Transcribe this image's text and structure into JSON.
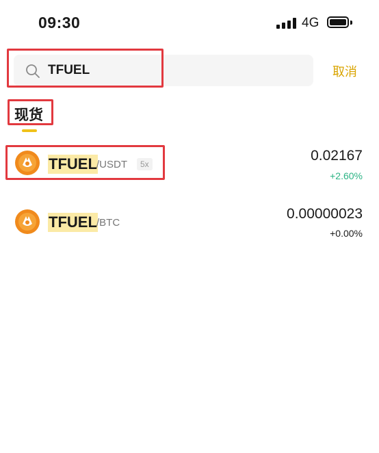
{
  "status_bar": {
    "time": "09:30",
    "network": "4G"
  },
  "search": {
    "value": "TFUEL",
    "cancel_label": "取消"
  },
  "tabs": [
    {
      "label": "现货",
      "active": true
    }
  ],
  "results": [
    {
      "symbol": "TFUEL",
      "quote": "/USDT",
      "leverage": "5x",
      "price": "0.02167",
      "change": "+2.60%",
      "direction": "up"
    },
    {
      "symbol": "TFUEL",
      "quote": "/BTC",
      "price": "0.00000023",
      "change": "+0.00%",
      "direction": "flat"
    }
  ],
  "colors": {
    "accent": "#f0c21a",
    "cancel": "#d9a400",
    "positive": "#2bb384",
    "highlight": "#e2393f",
    "coin": "#f08a1c"
  },
  "icons": {
    "search": "search-icon",
    "coin": "tfuel-coin-icon"
  }
}
